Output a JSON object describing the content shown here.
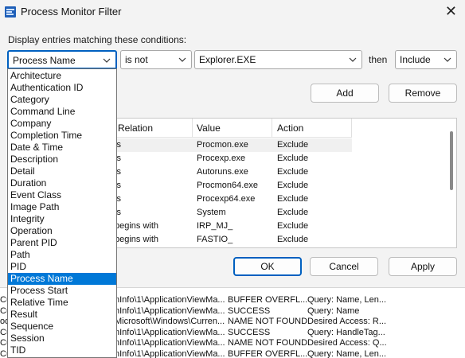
{
  "window": {
    "title": "Process Monitor Filter"
  },
  "prompt": "Display entries matching these conditions:",
  "condition": {
    "column": "Process Name",
    "relation": "is not",
    "value": "Explorer.EXE",
    "then_label": "then",
    "action": "Include"
  },
  "buttons": {
    "add": "Add",
    "remove": "Remove",
    "ok": "OK",
    "cancel": "Cancel",
    "apply": "Apply"
  },
  "rules": {
    "headers": [
      "Relation",
      "Value",
      "Action"
    ],
    "rows": [
      {
        "relation": "is",
        "value": "Procmon.exe",
        "action": "Exclude"
      },
      {
        "relation": "is",
        "value": "Procexp.exe",
        "action": "Exclude"
      },
      {
        "relation": "is",
        "value": "Autoruns.exe",
        "action": "Exclude"
      },
      {
        "relation": "is",
        "value": "Procmon64.exe",
        "action": "Exclude"
      },
      {
        "relation": "is",
        "value": "Procexp64.exe",
        "action": "Exclude"
      },
      {
        "relation": "is",
        "value": "System",
        "action": "Exclude"
      },
      {
        "relation": "begins with",
        "value": "IRP_MJ_",
        "action": "Exclude"
      },
      {
        "relation": "begins with",
        "value": "FASTIO_",
        "action": "Exclude"
      }
    ]
  },
  "dropdown": {
    "items": [
      "Architecture",
      "Authentication ID",
      "Category",
      "Command Line",
      "Company",
      "Completion Time",
      "Date & Time",
      "Description",
      "Detail",
      "Duration",
      "Event Class",
      "Image Path",
      "Integrity",
      "Operation",
      "Parent PID",
      "Path",
      "PID",
      "Process Name",
      "Process Start",
      "Relative Time",
      "Result",
      "Sequence",
      "Session",
      "TID"
    ],
    "selected": "Process Name"
  },
  "background_rows": [
    {
      "c1": "Cu",
      "c2": "nInfo\\1\\ApplicationViewMa...",
      "c3": "BUFFER OVERFL...",
      "c4": "Query: Name, Len..."
    },
    {
      "c1": "Cu",
      "c2": "nInfo\\1\\ApplicationViewMa...",
      "c3": "SUCCESS",
      "c4": "Query: Name"
    },
    {
      "c1": "od",
      "c2": "Microsoft\\Windows\\Curren...",
      "c3": "NAME NOT FOUND",
      "c4": "Desired Access: R..."
    },
    {
      "c1": "Cu",
      "c2": "nInfo\\1\\ApplicationViewMa...",
      "c3": "SUCCESS",
      "c4": "Query: HandleTag..."
    },
    {
      "c1": "Cu",
      "c2": "nInfo\\1\\ApplicationViewMa...",
      "c3": "NAME NOT FOUND",
      "c4": "Desired Access: Q..."
    },
    {
      "c1": "Cu",
      "c2": "nInfo\\1\\ApplicationViewMa...",
      "c3": "BUFFER OVERFL...",
      "c4": "Query: Name, Len..."
    }
  ]
}
